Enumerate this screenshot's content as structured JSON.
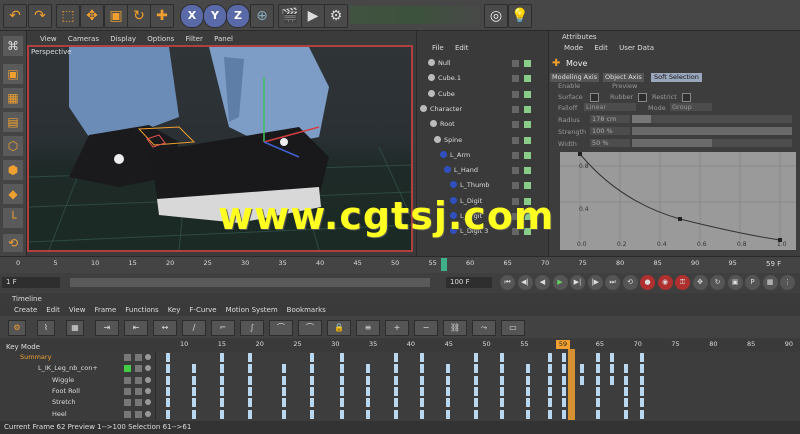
{
  "toolbar": {
    "icons": [
      "undo-icon",
      "redo-icon",
      "select-icon",
      "move-icon",
      "scale-icon",
      "rotate-icon",
      "live-select-icon"
    ],
    "axes": [
      "X",
      "Y",
      "Z"
    ]
  },
  "viewport": {
    "menu": [
      "View",
      "Cameras",
      "Display",
      "Options",
      "Filter",
      "Panel"
    ],
    "label": "Perspective"
  },
  "objects": {
    "menu": [
      "File",
      "Edit"
    ],
    "rows": [
      {
        "name": "Null",
        "indent": 8
      },
      {
        "name": "Cube.1",
        "indent": 8
      },
      {
        "name": "Cube",
        "indent": 8
      },
      {
        "name": "Character",
        "indent": 0
      },
      {
        "name": "Root",
        "indent": 10
      },
      {
        "name": "Spine",
        "indent": 14
      },
      {
        "name": "L_Arm",
        "indent": 20
      },
      {
        "name": "L_Hand",
        "indent": 24
      },
      {
        "name": "L_Thumb",
        "indent": 30
      },
      {
        "name": "L_Digit",
        "indent": 30
      },
      {
        "name": "L_Digit",
        "indent": 30
      },
      {
        "name": "L_Digit 3",
        "indent": 30
      }
    ]
  },
  "attributes": {
    "title": "Attributes",
    "menu": [
      "Mode",
      "Edit",
      "User Data"
    ],
    "tool": "Move",
    "tabs": [
      "Modeling Axis",
      "Object Axis",
      "Soft Selection"
    ],
    "fields": {
      "mode_label": "Enable",
      "mode_value": "Preview",
      "surface": "Surface",
      "rubber": "Rubber",
      "restrict": "Restrict",
      "falloff_label": "Falloff",
      "falloff_value": "Linear",
      "mode2_label": "Mode",
      "mode2_value": "Group",
      "radius_label": "Radius",
      "radius_value": "178 cm",
      "strength_label": "Strength",
      "strength_value": "100 %",
      "width_label": "Width",
      "width_value": "50 %"
    },
    "graph_y": [
      "0.8",
      "0.4"
    ],
    "graph_x": [
      "0.0",
      "0.2",
      "0.4",
      "0.6",
      "0.8",
      "1.0"
    ]
  },
  "timeline_ruler": {
    "ticks": [
      "0",
      "5",
      "10",
      "15",
      "20",
      "25",
      "30",
      "35",
      "40",
      "45",
      "50",
      "55",
      "60",
      "65",
      "70",
      "75",
      "80",
      "85",
      "90",
      "95",
      "100"
    ],
    "end": "59 F"
  },
  "transport": {
    "start": "1 F",
    "end": "100 F",
    "mid": "10.0 F"
  },
  "timeline": {
    "title": "Timeline",
    "menu": [
      "Create",
      "Edit",
      "View",
      "Frame",
      "Functions",
      "Key",
      "F-Curve",
      "Motion System",
      "Bookmarks"
    ],
    "mode": "Key Mode",
    "ruler": [
      "10",
      "15",
      "20",
      "25",
      "30",
      "35",
      "40",
      "45",
      "50",
      "55",
      "60",
      "65",
      "70",
      "75",
      "80",
      "85",
      "90"
    ],
    "current": "59",
    "tracks": [
      "Summary",
      "L_IK_Leg_nb_con+",
      "Wiggle",
      "Foot Roll",
      "Stretch",
      "Heel"
    ]
  },
  "status": "Current Frame  62  Preview  1-->100   Selection 61-->61",
  "watermark": "www.cgtsj.com",
  "colors": {
    "accent": "#f0a030",
    "bg": "#3b3b3b",
    "key": "#b9d8f0",
    "current": "#f0a030",
    "axis_x": "#d04040",
    "axis_y": "#40c060",
    "axis_z": "#4060d0"
  }
}
